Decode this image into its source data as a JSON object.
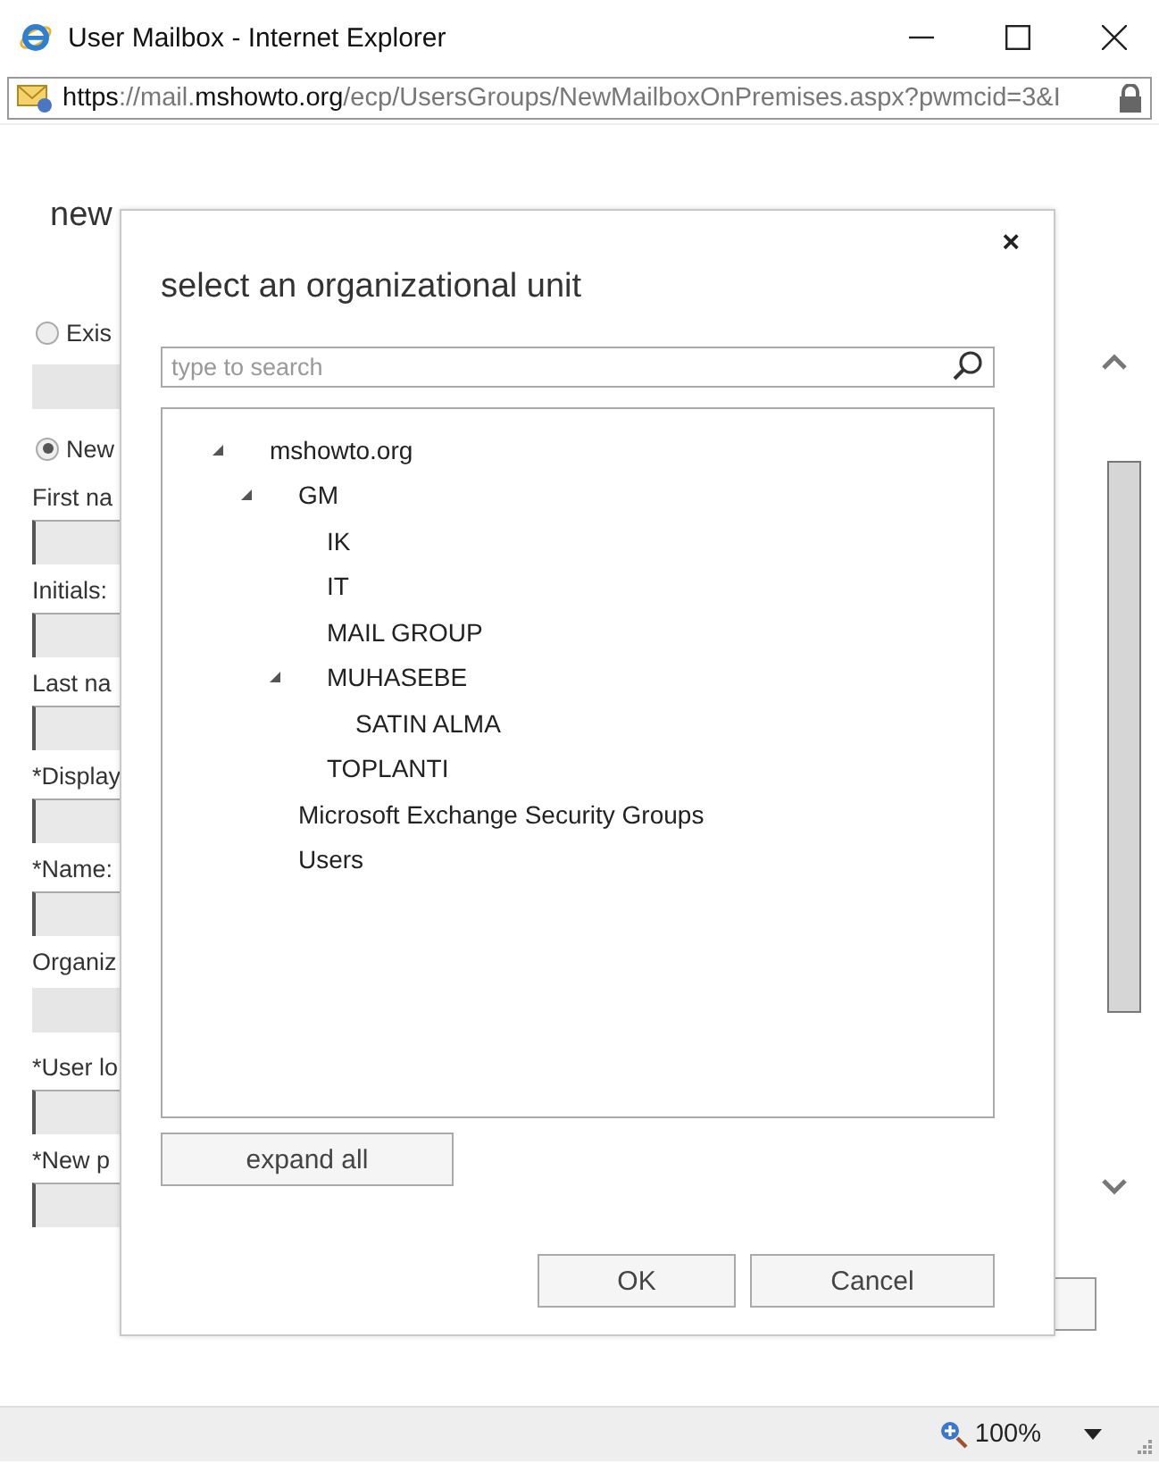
{
  "window": {
    "title": "User Mailbox - Internet Explorer"
  },
  "address_bar": {
    "url": "**https**://mail.**mshowto.org**/ecp/UsersGroups/NewMailboxOnPremises.aspx?pwmcid=3&I"
  },
  "form": {
    "heading": "new",
    "items": [
      {
        "kind": "radio",
        "label": "Exis",
        "selected": false
      },
      {
        "kind": "input",
        "disabled": true
      },
      {
        "kind": "radio",
        "label": "New",
        "selected": true
      },
      {
        "kind": "label",
        "text": "First na"
      },
      {
        "kind": "input",
        "disabled": false
      },
      {
        "kind": "label",
        "text": "Initials:"
      },
      {
        "kind": "input",
        "disabled": false
      },
      {
        "kind": "label",
        "text": "Last na"
      },
      {
        "kind": "input",
        "disabled": false
      },
      {
        "kind": "label",
        "text": "*Display"
      },
      {
        "kind": "input",
        "disabled": false
      },
      {
        "kind": "label",
        "text": "*Name:"
      },
      {
        "kind": "input",
        "disabled": false
      },
      {
        "kind": "label",
        "text": "Organiz"
      },
      {
        "kind": "input",
        "disabled": true
      },
      {
        "kind": "label",
        "text": "*User lo"
      },
      {
        "kind": "input",
        "disabled": false
      },
      {
        "kind": "label",
        "text": "*New p"
      },
      {
        "kind": "input",
        "disabled": false
      }
    ]
  },
  "dialog": {
    "close": "×",
    "title": "select an organizational unit",
    "search": {
      "placeholder": "type to search"
    },
    "tree": [
      {
        "label": "mshowto.org",
        "expanded": true,
        "children": [
          {
            "label": "GM",
            "expanded": true,
            "children": [
              {
                "label": "IK"
              },
              {
                "label": "IT"
              },
              {
                "label": "MAIL GROUP"
              },
              {
                "label": "MUHASEBE",
                "expanded": true,
                "children": [
                  {
                    "label": "SATIN ALMA"
                  }
                ]
              },
              {
                "label": "TOPLANTI"
              }
            ]
          },
          {
            "label": "Microsoft Exchange Security Groups"
          },
          {
            "label": "Users"
          }
        ]
      }
    ],
    "expand_button": "expand all",
    "buttons": [
      "OK",
      "Cancel"
    ]
  },
  "status_bar": {
    "zoom": "100%"
  }
}
